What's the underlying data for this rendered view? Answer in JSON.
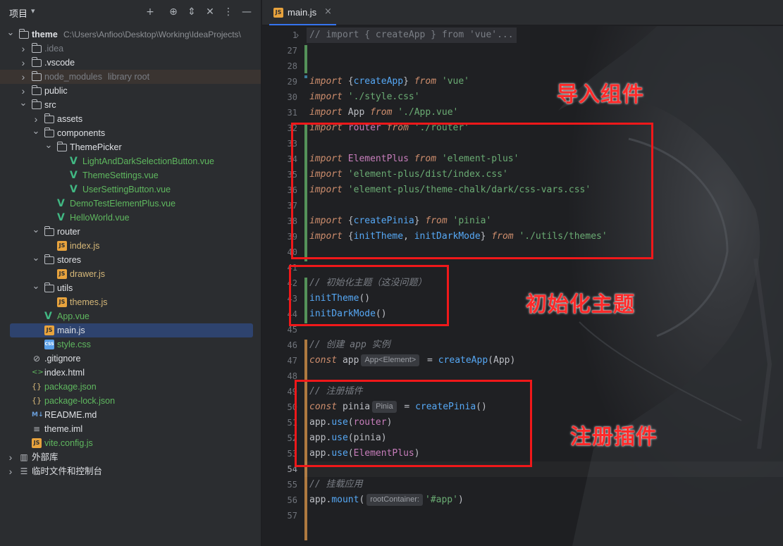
{
  "project_panel": {
    "title": "项目",
    "root_name": "theme",
    "root_path": "C:\\Users\\Anfioo\\Desktop\\Working\\IdeaProjects\\",
    "tree": [
      {
        "label": "theme",
        "depth": 0
      },
      {
        "label": ".idea",
        "depth": 1
      },
      {
        "label": ".vscode",
        "depth": 1
      },
      {
        "label": "node_modules",
        "suffix": "library root",
        "depth": 1
      },
      {
        "label": "public",
        "depth": 1
      },
      {
        "label": "src",
        "depth": 1
      },
      {
        "label": "assets",
        "depth": 2
      },
      {
        "label": "components",
        "depth": 2
      },
      {
        "label": "ThemePicker",
        "depth": 3
      },
      {
        "label": "LightAndDarkSelectionButton.vue",
        "depth": 4
      },
      {
        "label": "ThemeSettings.vue",
        "depth": 4
      },
      {
        "label": "UserSettingButton.vue",
        "depth": 4
      },
      {
        "label": "DemoTestElementPlus.vue",
        "depth": 3
      },
      {
        "label": "HelloWorld.vue",
        "depth": 3
      },
      {
        "label": "router",
        "depth": 2
      },
      {
        "label": "index.js",
        "depth": 3
      },
      {
        "label": "stores",
        "depth": 2
      },
      {
        "label": "drawer.js",
        "depth": 3
      },
      {
        "label": "utils",
        "depth": 2
      },
      {
        "label": "themes.js",
        "depth": 3
      },
      {
        "label": "App.vue",
        "depth": 2
      },
      {
        "label": "main.js",
        "depth": 2
      },
      {
        "label": "style.css",
        "depth": 2
      },
      {
        "label": ".gitignore",
        "depth": 1
      },
      {
        "label": "index.html",
        "depth": 1
      },
      {
        "label": "package.json",
        "depth": 1
      },
      {
        "label": "package-lock.json",
        "depth": 1
      },
      {
        "label": "README.md",
        "depth": 1
      },
      {
        "label": "theme.iml",
        "depth": 1
      },
      {
        "label": "vite.config.js",
        "depth": 1
      },
      {
        "label": "外部库",
        "depth": 0
      },
      {
        "label": "临时文件和控制台",
        "depth": 0
      }
    ],
    "selected": "main.js"
  },
  "editor": {
    "tab_label": "main.js",
    "folded_line": "// import { createApp } from 'vue'...",
    "line_numbers": [
      "1",
      "27",
      "28",
      "29",
      "30",
      "31",
      "32",
      "33",
      "34",
      "35",
      "36",
      "37",
      "38",
      "39",
      "40",
      "41",
      "42",
      "43",
      "44",
      "45",
      "46",
      "47",
      "48",
      "49",
      "50",
      "51",
      "52",
      "53",
      "54",
      "55",
      "56",
      "57"
    ],
    "inlay_app": "App<Element>",
    "inlay_pinia": "Pinia",
    "inlay_mount": "rootContainer:",
    "comment_init": "// 初始化主题（这没问题）",
    "comment_create": "// 创建 app 实例",
    "comment_plugins": "// 注册插件",
    "comment_mount": "// 挂载应用"
  },
  "annotations": {
    "import_components": "导入组件",
    "init_theme": "初始化主题",
    "register_plugins": "注册插件",
    "color": "#f0181a"
  }
}
